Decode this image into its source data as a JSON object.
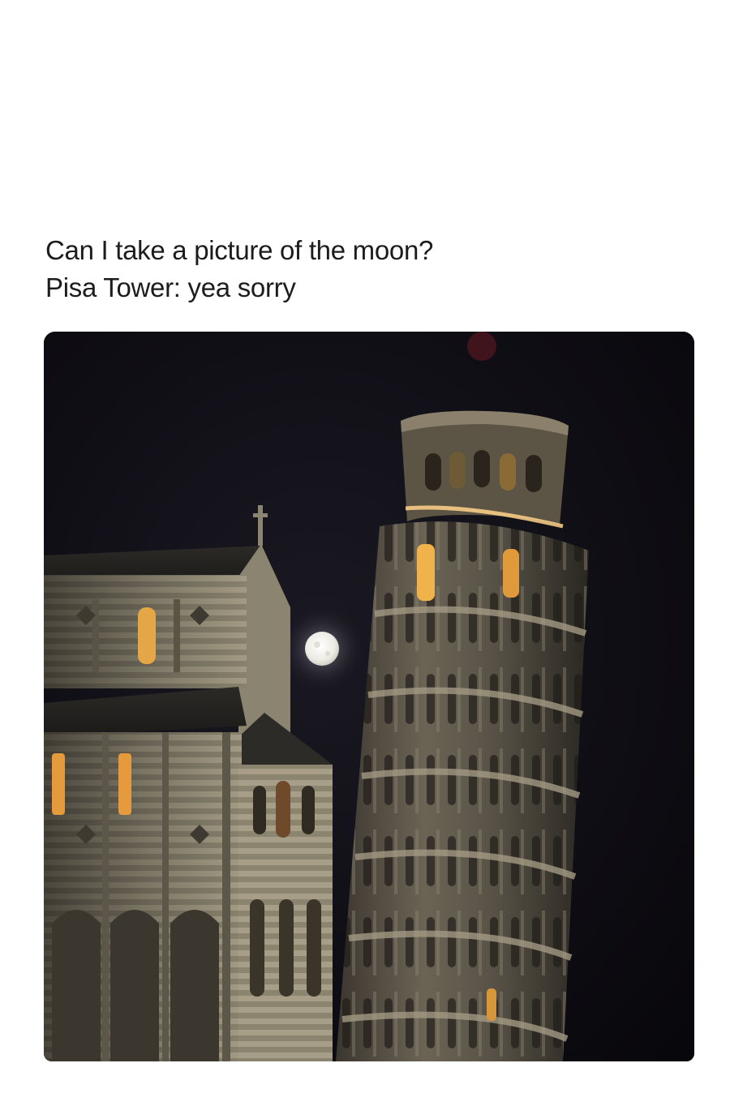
{
  "post": {
    "caption_line_1": "Can I take a picture of the moon?",
    "caption_line_2": "Pisa Tower: yea sorry"
  },
  "photo": {
    "subject_icons": [
      "moon-icon",
      "leaning-tower-icon",
      "cathedral-icon"
    ],
    "colors": {
      "night_sky": "#0d0c12",
      "stone_lit": "#8d8673",
      "stone_shadow": "#3a3630",
      "window_glow": "#f0b24a",
      "moon": "#f4f2ea"
    }
  }
}
